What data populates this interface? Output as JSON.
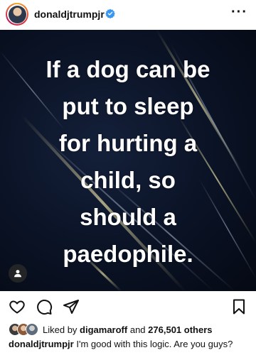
{
  "header": {
    "username": "donaldjtrumpjr",
    "avatar_icon": "profile-avatar",
    "verified_icon": "verified-badge-icon",
    "more_icon": "more-options-icon",
    "more_glyph": "···"
  },
  "post": {
    "text_lines": [
      "If a dog can be",
      "put to sleep",
      "for hurting a",
      "child, so",
      "should a",
      "paedophile."
    ],
    "background_color": "#0a1224",
    "tag_icon": "user-tag-icon"
  },
  "actions": {
    "like_icon": "heart-icon",
    "comment_icon": "comment-icon",
    "share_icon": "send-icon",
    "save_icon": "bookmark-icon"
  },
  "likes": {
    "prefix": "Liked by",
    "liker": "digamaroff",
    "connector": "and",
    "count": "276,501 others"
  },
  "caption": {
    "username": "donaldjtrumpjr",
    "text": "I'm good with this logic. Are you guys?"
  },
  "colors": {
    "verified": "#3897f0",
    "text": "#111111"
  }
}
